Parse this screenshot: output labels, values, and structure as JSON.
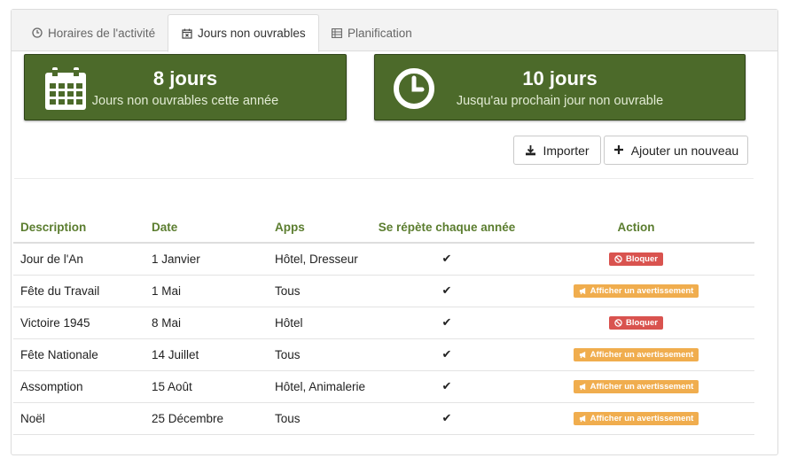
{
  "tabs": [
    {
      "label": "Horaires de l'activité",
      "icon": "clock-icon",
      "active": false
    },
    {
      "label": "Jours non ouvrables",
      "icon": "calendar-x-icon",
      "active": true
    },
    {
      "label": "Planification",
      "icon": "table-icon",
      "active": false
    }
  ],
  "stats": [
    {
      "value": "8 jours",
      "caption": "Jours non ouvrables cette année",
      "icon": "calendar-icon"
    },
    {
      "value": "10 jours",
      "caption": "Jusqu'au prochain jour non ouvrable",
      "icon": "clock-icon"
    }
  ],
  "toolbar": {
    "import_label": "Importer",
    "add_label": "Ajouter un nouveau"
  },
  "table": {
    "columns": [
      "Description",
      "Date",
      "Apps",
      "Se répète chaque année",
      "Action"
    ],
    "rows": [
      {
        "description": "Jour de l'An",
        "date": "1 Janvier",
        "apps": "Hôtel, Dresseur",
        "repeats": "✔",
        "action": "Bloquer",
        "action_type": "danger"
      },
      {
        "description": "Fête du Travail",
        "date": "1 Mai",
        "apps": "Tous",
        "repeats": "✔",
        "action": "Afficher un avertissement",
        "action_type": "warning"
      },
      {
        "description": "Victoire 1945",
        "date": "8 Mai",
        "apps": "Hôtel",
        "repeats": "✔",
        "action": "Bloquer",
        "action_type": "danger"
      },
      {
        "description": "Fête Nationale",
        "date": "14 Juillet",
        "apps": "Tous",
        "repeats": "✔",
        "action": "Afficher un avertissement",
        "action_type": "warning"
      },
      {
        "description": "Assomption",
        "date": "15 Août",
        "apps": "Hôtel, Animalerie",
        "repeats": "✔",
        "action": "Afficher un avertissement",
        "action_type": "warning"
      },
      {
        "description": "Noël",
        "date": "25 Décembre",
        "apps": "Tous",
        "repeats": "✔",
        "action": "Afficher un avertissement",
        "action_type": "warning"
      }
    ]
  },
  "colors": {
    "accent": "#4c6a2a",
    "header_text": "#5b7d2f",
    "danger": "#d9534f",
    "warning": "#f0ad4e"
  }
}
